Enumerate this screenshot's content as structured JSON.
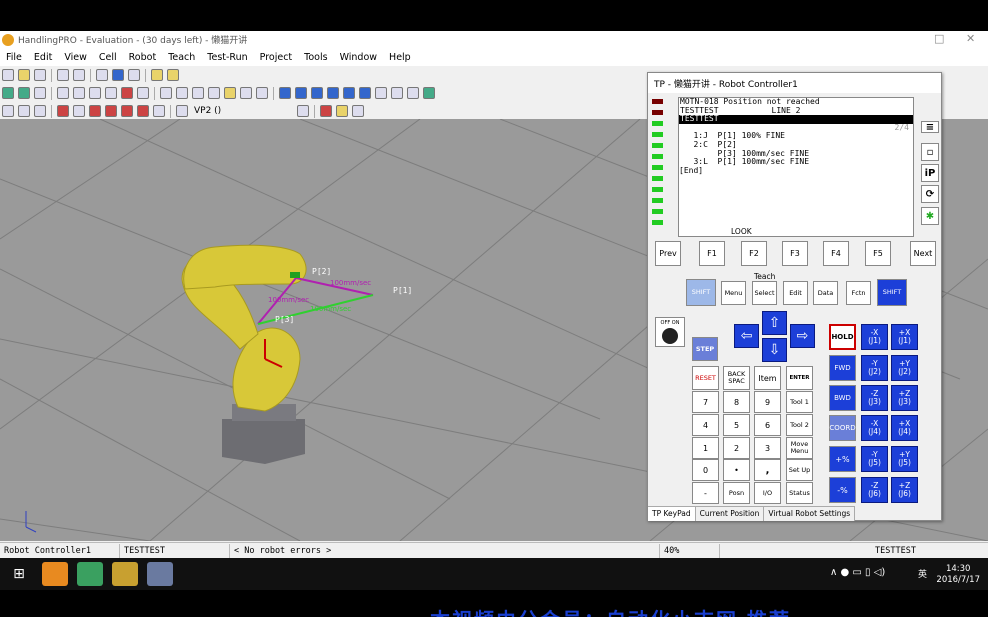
{
  "window": {
    "title": "HandlingPRO - Evaluation - (30 days left) - 懒猫开讲",
    "min": "—",
    "max": "□",
    "close": "✕"
  },
  "menu": [
    "File",
    "Edit",
    "View",
    "Cell",
    "Robot",
    "Teach",
    "Test-Run",
    "Project",
    "Tools",
    "Window",
    "Help"
  ],
  "toolbar": {
    "viewpoint": "VP2 ()"
  },
  "scene": {
    "pr_labels": [
      "P[2]",
      "P[1]",
      "P[3]"
    ],
    "speed_labels": [
      "100mm/sec",
      "100mm/sec",
      "100mm/sec"
    ]
  },
  "status": {
    "controller": "Robot Controller1",
    "program": "TESTTEST",
    "errors": "< No robot errors >",
    "percent": "40%",
    "program_right": "TESTTEST"
  },
  "tp": {
    "title": "TP - 懒猫开讲 - Robot Controller1",
    "lcd": {
      "line1": "MOTN-018 Position not reached",
      "line2": "TESTTEST           LINE 2",
      "line3": "TESTTEST",
      "page": "2/4",
      "prog": [
        "   1:J  P[1] 100% FINE",
        "   2:C  P[2]",
        "        P[3] 100mm/sec FINE",
        "   3:L  P[1] 100mm/sec FINE",
        "[End]"
      ],
      "look": "LOOK"
    },
    "fkeys": [
      "Prev",
      "F1",
      "F2",
      "F3",
      "F4",
      "F5",
      "Next"
    ],
    "teach_label": "Teach",
    "row2": [
      "SHIFT",
      "Menu",
      "Select",
      "Edit",
      "Data",
      "Fctn",
      "SHIFT"
    ],
    "offon": "OFF ON",
    "step": "STEP",
    "keypad": [
      [
        "RESET",
        "BACK SPAC",
        "Item",
        "ENTER"
      ],
      [
        "7",
        "8",
        "9",
        "Tool 1"
      ],
      [
        "4",
        "5",
        "6",
        "Tool 2"
      ],
      [
        "1",
        "2",
        "3",
        "Move Menu"
      ],
      [
        "0",
        "•",
        ",",
        "Set Up"
      ],
      [
        "-",
        "Posn",
        "I/O",
        "Status"
      ]
    ],
    "hold": "HOLD",
    "fwd": "FWD",
    "bwd": "BWD",
    "coord": "COORD",
    "plus_pct": "+%",
    "minus_pct": "-%",
    "jog": [
      [
        "-X",
        "(J1)",
        "+X",
        "(J1)"
      ],
      [
        "-Y",
        "(J2)",
        "+Y",
        "(J2)"
      ],
      [
        "-Z",
        "(J3)",
        "+Z",
        "(J3)"
      ],
      [
        "-X",
        "(J4)",
        "+X",
        "(J4)"
      ],
      [
        "-Y",
        "(J5)",
        "+Y",
        "(J5)"
      ],
      [
        "-Z",
        "(J6)",
        "+Z",
        "(J6)"
      ]
    ],
    "tabs": [
      "TP KeyPad",
      "Current Position",
      "Virtual Robot Settings"
    ],
    "side_ip": "iP"
  },
  "taskbar": {
    "time": "14:30",
    "date": "2016/7/17",
    "ime": "英"
  },
  "overlay_subtitle": "本视频由分会员：自动化小吉网 推荐",
  "colors": {
    "accent_blue": "#1c3fd8",
    "robot_yellow": "#d8c838",
    "ground": "#9a9a9a"
  }
}
